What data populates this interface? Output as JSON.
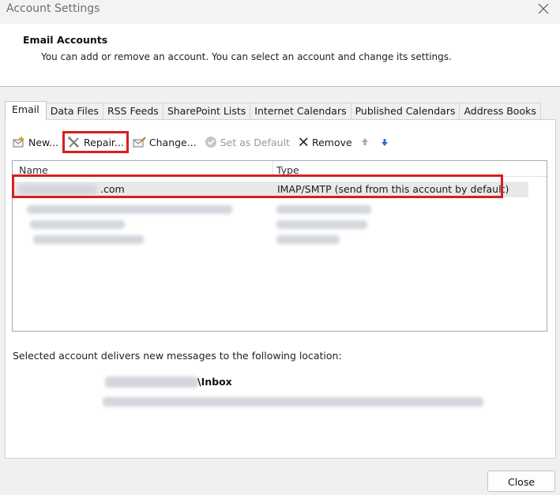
{
  "window": {
    "title": "Account Settings"
  },
  "header": {
    "title": "Email Accounts",
    "subtitle": "You can add or remove an account. You can select an account and change its settings."
  },
  "tabs": [
    {
      "label": "Email",
      "active": true
    },
    {
      "label": "Data Files"
    },
    {
      "label": "RSS Feeds"
    },
    {
      "label": "SharePoint Lists"
    },
    {
      "label": "Internet Calendars"
    },
    {
      "label": "Published Calendars"
    },
    {
      "label": "Address Books"
    }
  ],
  "toolbar": {
    "new_label": "New...",
    "repair_label": "Repair...",
    "change_label": "Change...",
    "set_default_label": "Set as Default",
    "remove_label": "Remove"
  },
  "accounts_list": {
    "columns": {
      "name": "Name",
      "type": "Type"
    },
    "selected_row": {
      "name": ".com",
      "type": "IMAP/SMTP (send from this account by default)"
    }
  },
  "delivery": {
    "label": "Selected account delivers new messages to the following location:",
    "location": "\\Inbox"
  },
  "footer": {
    "close_label": "Close"
  },
  "colors": {
    "highlight": "#d81e1e",
    "selected_row": "#e8e8e8"
  }
}
